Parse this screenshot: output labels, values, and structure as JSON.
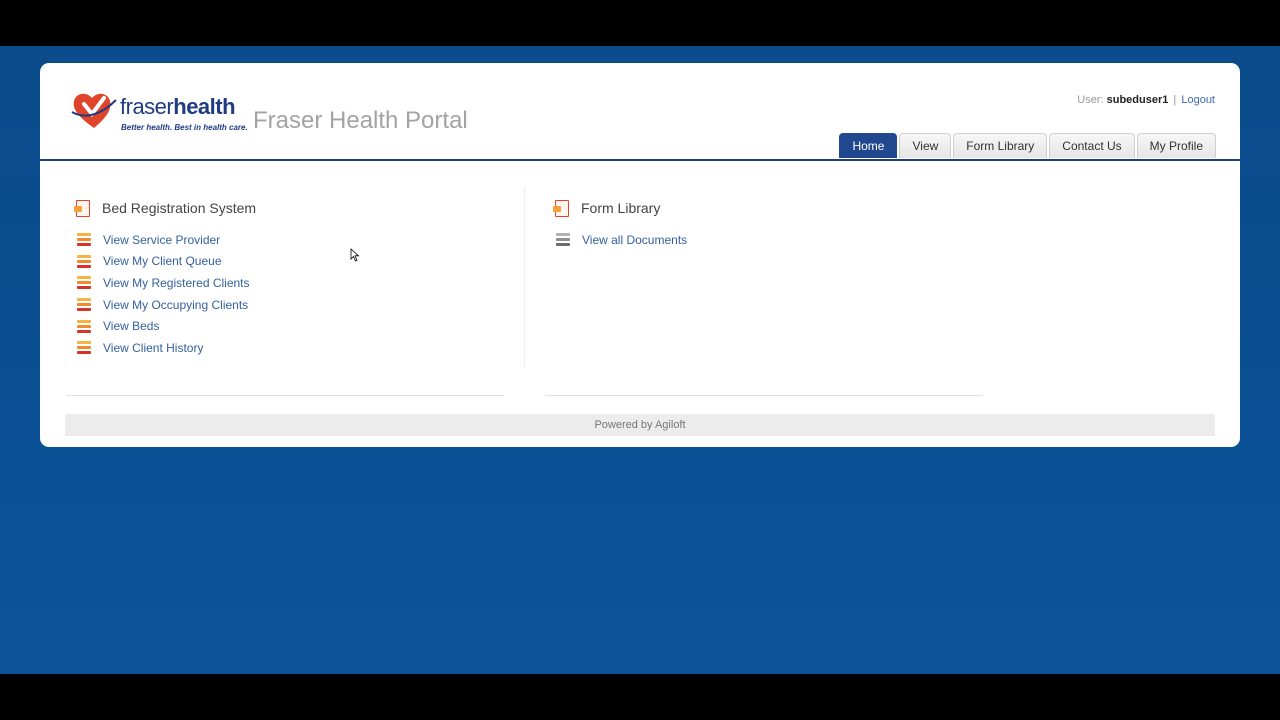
{
  "header": {
    "logo": {
      "word_light": "fraser",
      "word_bold": "health",
      "tagline": "Better health. Best in health care."
    },
    "portal_title": "Fraser Health Portal",
    "user": {
      "label": "User:",
      "name": "subeduser1",
      "separator": "|",
      "logout_label": "Logout"
    },
    "tabs": [
      {
        "label": "Home",
        "active": true
      },
      {
        "label": "View",
        "active": false
      },
      {
        "label": "Form Library",
        "active": false
      },
      {
        "label": "Contact Us",
        "active": false
      },
      {
        "label": "My Profile",
        "active": false
      }
    ]
  },
  "sections": {
    "bed_registration": {
      "title": "Bed Registration System",
      "links": [
        "View Service Provider",
        "View My Client Queue",
        "View My Registered Clients",
        "View My Occupying Clients",
        "View Beds",
        "View Client History"
      ]
    },
    "form_library": {
      "title": "Form Library",
      "links": [
        "View all Documents"
      ]
    }
  },
  "footer": {
    "powered_by": "Powered by Agiloft"
  },
  "colors": {
    "background": "#0b4c8c",
    "active_tab": "#21478f",
    "link": "#34609f",
    "brand_red": "#e0452c"
  }
}
